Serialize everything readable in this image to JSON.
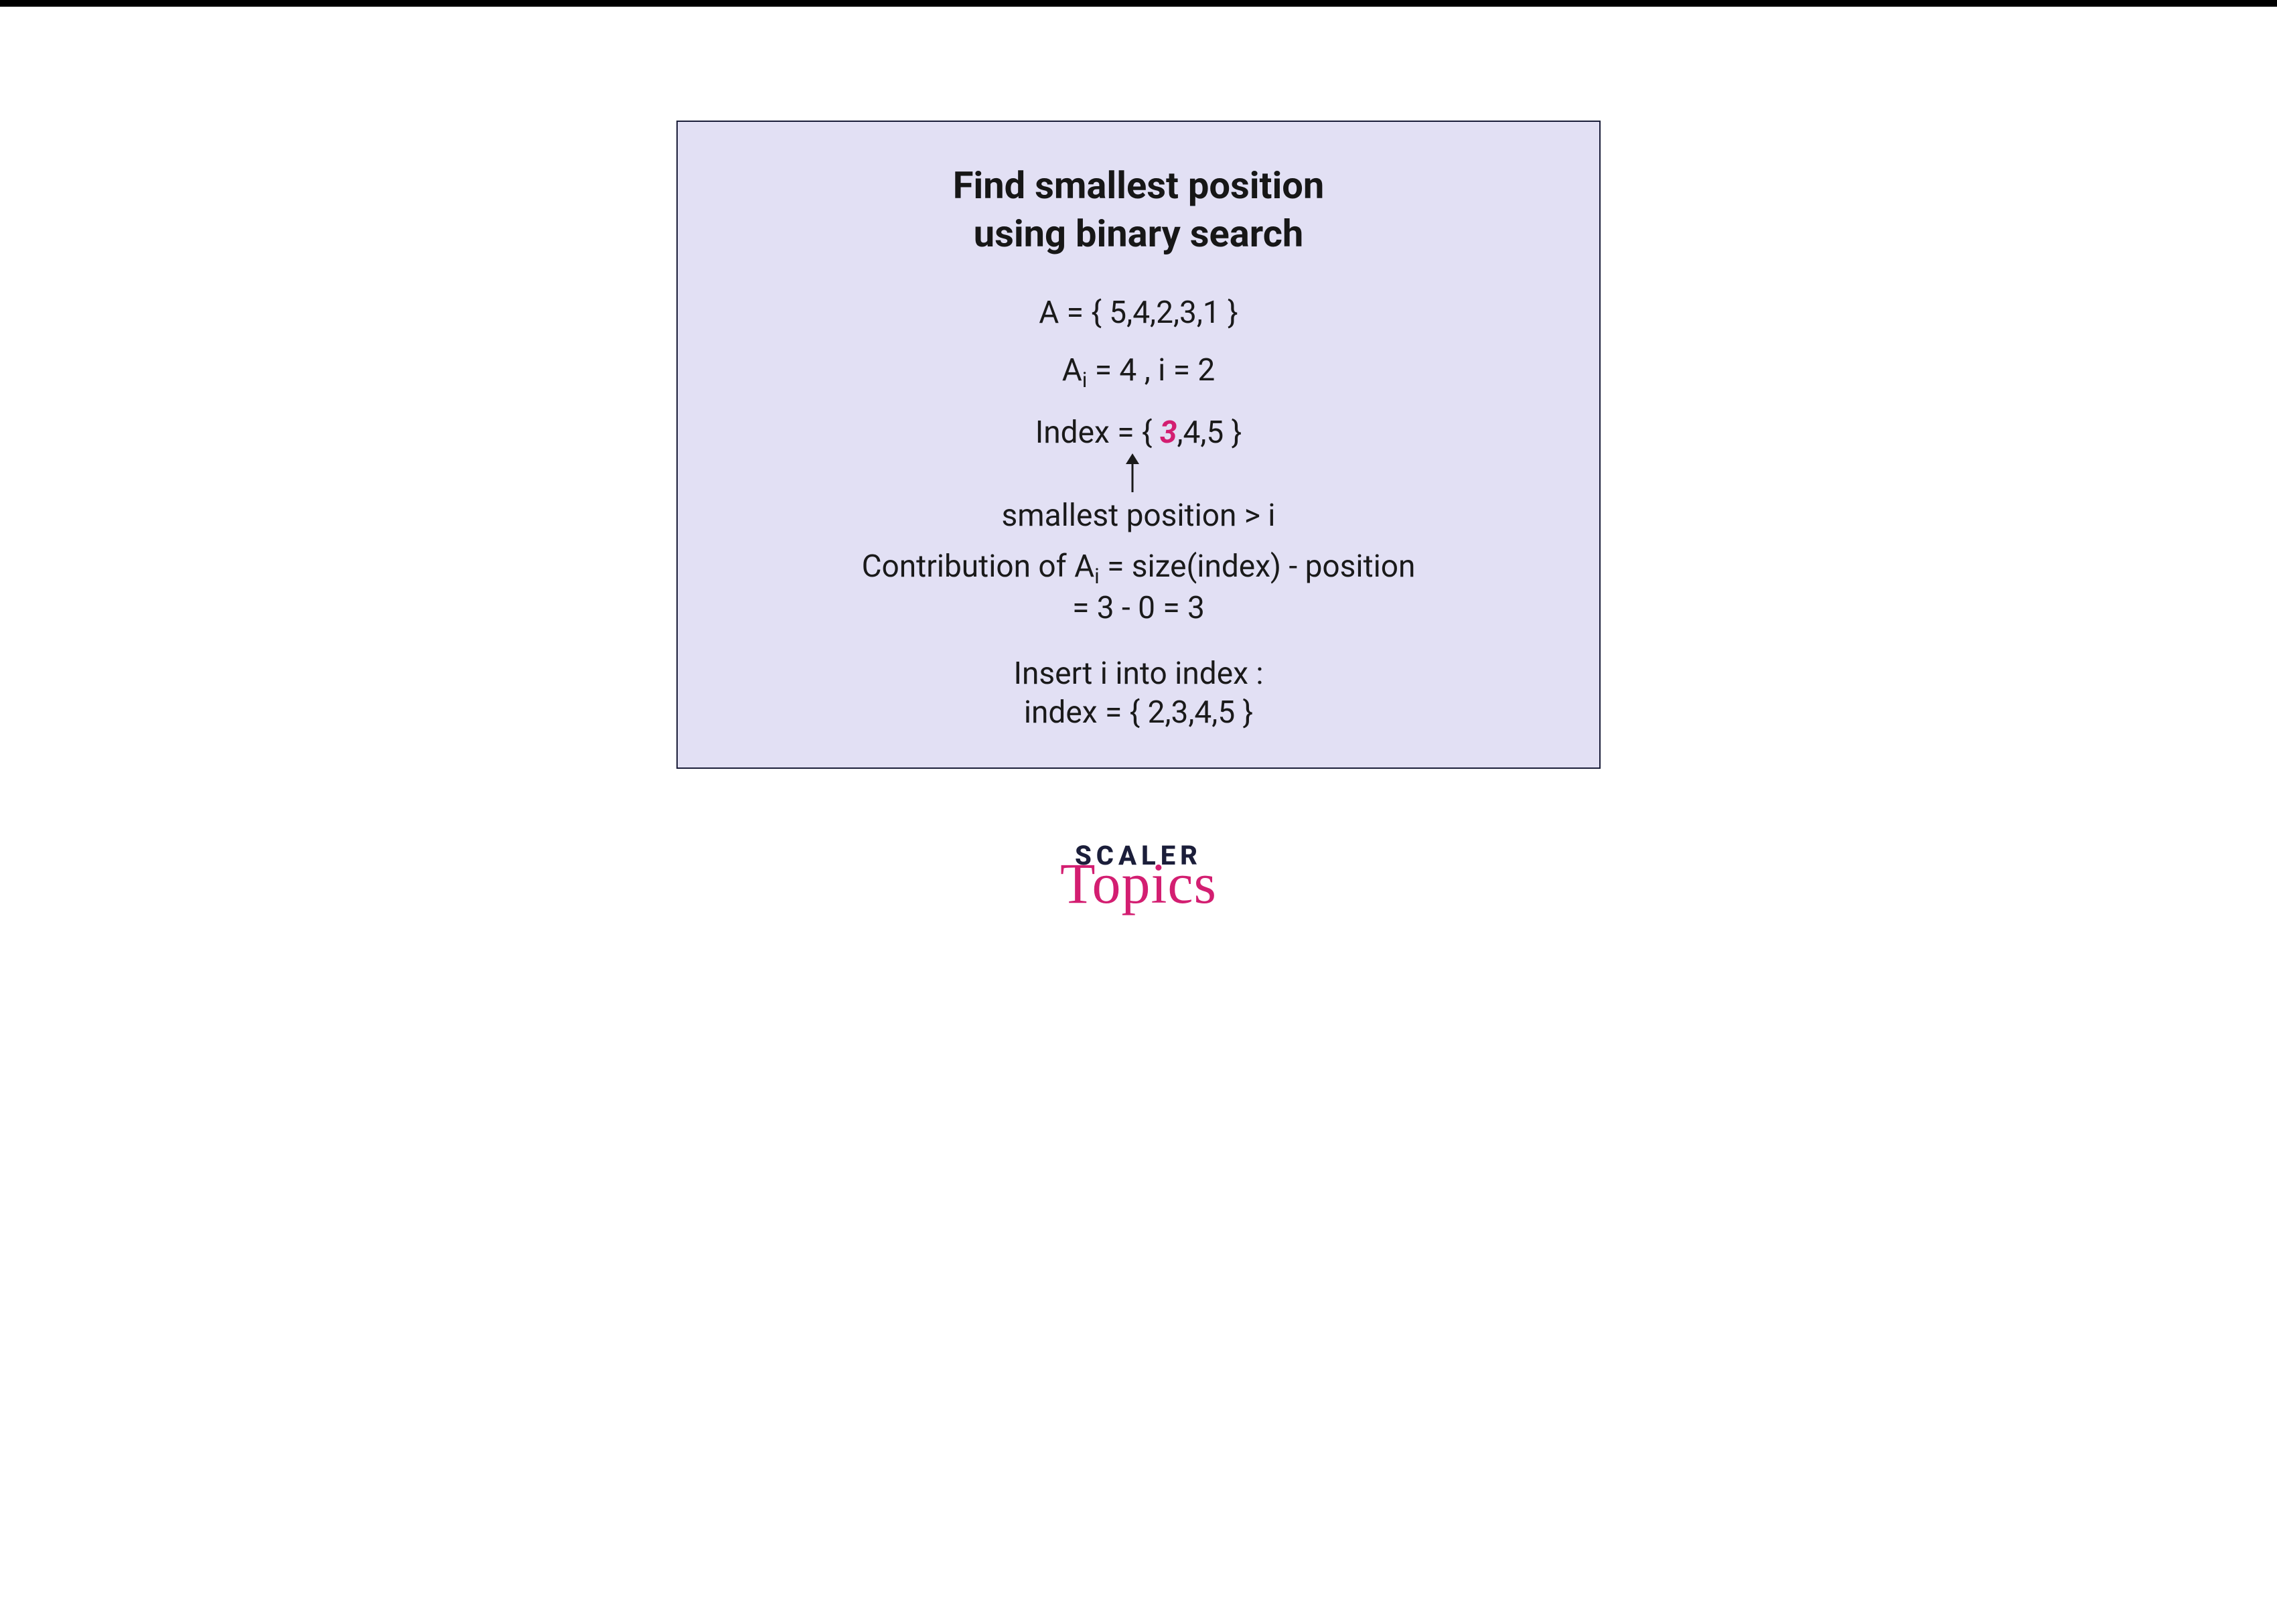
{
  "panel": {
    "title_line1": "Find smallest position",
    "title_line2": "using binary search",
    "A_line": "A = { 5,4,2,3,1 }",
    "Ai_line_pre": "A",
    "Ai_line_sub": "i",
    "Ai_line_post": " = 4 , i = 2",
    "index_pre": "Index = { ",
    "index_hl": "3",
    "index_post": ",4,5 }",
    "smallest": "smallest position > i",
    "contrib1_pre": "Contribution of A",
    "contrib1_sub": "i",
    "contrib1_post": " = size(index) - position",
    "contrib2": "= 3 - 0 = 3",
    "insert1": "Insert i into index :",
    "insert2": "index = { 2,3,4,5 }"
  },
  "logo": {
    "scaler": "SCALER",
    "topics": "Topics"
  },
  "chart_data": {
    "type": "diagram",
    "title": "Find smallest position using binary search",
    "array_A": [
      5,
      4,
      2,
      3,
      1
    ],
    "current_element": {
      "value": 4,
      "index_i": 2
    },
    "index_set_before": [
      3,
      4,
      5
    ],
    "highlighted_index_value": 3,
    "arrow_label": "smallest position > i",
    "contribution": {
      "formula": "size(index) - position",
      "size_index": 3,
      "position": 0,
      "result": 3
    },
    "index_set_after_insert": [
      2,
      3,
      4,
      5
    ]
  }
}
